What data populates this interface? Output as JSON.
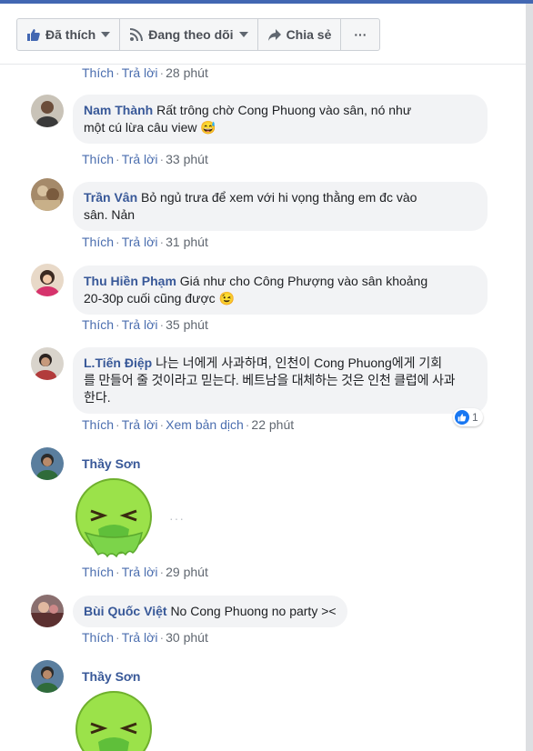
{
  "toolbar": {
    "liked_label": "Đã thích",
    "following_label": "Đang theo dõi",
    "share_label": "Chia sẻ",
    "more_label": "···"
  },
  "comments": [
    {
      "time": "28 phút"
    },
    {
      "name": "Nam Thành",
      "text_l1": "Rất trông chờ Cong Phuong vào sân, nó như",
      "text_l2": "một cú lừa câu view 😅",
      "time": "33 phút"
    },
    {
      "name": "Trần Vân",
      "text_l1": "Bỏ ngủ trưa để xem với hi vọng thằng em đc vào",
      "text_l2": "sân. Nản",
      "time": "31 phút"
    },
    {
      "name": "Thu Hiền Phạm",
      "text_l1": "Giá như cho Công Phượng vào sân khoảng",
      "text_l2": "20-30p cuối cũng được 😉",
      "time": "35 phút"
    },
    {
      "name": "L.Tiến Điệp",
      "text_l1": "나는 너에게 사과하며, 인천이 Cong Phuong에게 기회",
      "text_l2": "를 만들어 줄 것이라고 믿는다. 베트남을 대체하는 것은 인천 클럽에 사과",
      "text_l3": "한다.",
      "translate": "Xem bản dịch",
      "time": "22 phút",
      "reactions": "1"
    },
    {
      "name": "Thầy Sơn",
      "time": "29 phút"
    },
    {
      "name": "Bùi Quốc Việt",
      "text_l1": "No Cong Phuong no party ><",
      "time": "30 phút"
    },
    {
      "name": "Thầy Sơn"
    }
  ],
  "links": {
    "like": "Thích",
    "reply": "Trả lời",
    "sep": "·"
  },
  "sticker_more": "···",
  "colors": {
    "brand": "#4267b2",
    "name": "#385898",
    "link": "#4b6eaf",
    "bubble": "#f2f3f5",
    "sticker": "#9be24a"
  }
}
